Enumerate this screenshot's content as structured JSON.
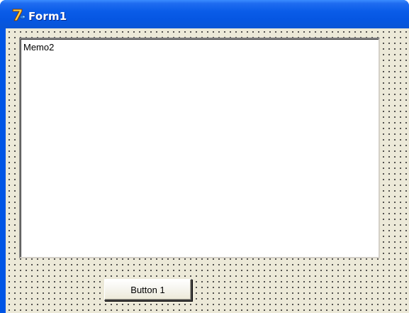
{
  "window": {
    "title": "Form1",
    "icon": "delphi-app-icon"
  },
  "memo": {
    "text": "Memo2"
  },
  "button": {
    "label": "Button 1"
  },
  "colors": {
    "titlebar": "#0a5ce8",
    "form_background": "#ece9d8",
    "grid_dot": "#2b2b2b",
    "memo_background": "#ffffff"
  }
}
